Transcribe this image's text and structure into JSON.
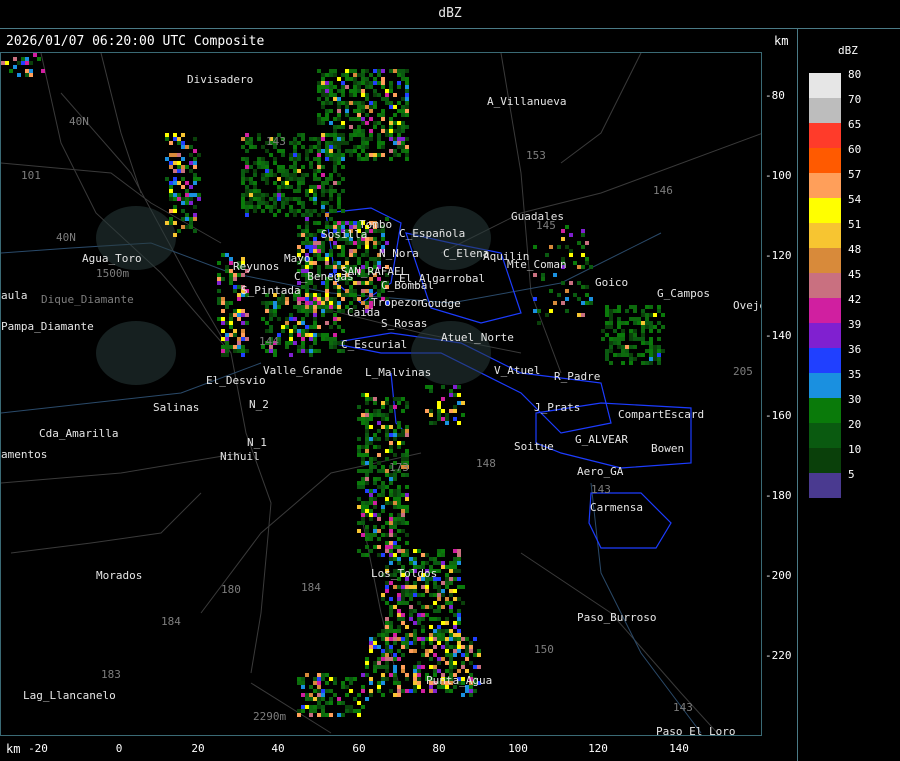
{
  "colorbar": {
    "title": "dBZ",
    "levels": [
      {
        "value": "80",
        "color": "#e6e6e6"
      },
      {
        "value": "70",
        "color": "#bdbdbd"
      },
      {
        "value": "65",
        "color": "#ff3b2a"
      },
      {
        "value": "60",
        "color": "#ff5a00"
      },
      {
        "value": "57",
        "color": "#ff9f5a"
      },
      {
        "value": "54",
        "color": "#ffff00"
      },
      {
        "value": "51",
        "color": "#f7c531"
      },
      {
        "value": "48",
        "color": "#d88a3a"
      },
      {
        "value": "45",
        "color": "#c97080"
      },
      {
        "value": "42",
        "color": "#d01fa0"
      },
      {
        "value": "39",
        "color": "#8020d0"
      },
      {
        "value": "36",
        "color": "#2040ff"
      },
      {
        "value": "35",
        "color": "#1a90e0"
      },
      {
        "value": "30",
        "color": "#0a7a0a"
      },
      {
        "value": "20",
        "color": "#0a5a10"
      },
      {
        "value": "10",
        "color": "#0a400a"
      },
      {
        "value": "5",
        "color": "#4a3a90"
      }
    ]
  },
  "header": {
    "timestamp": "2026/01/07 06:20:00 UTC Composite",
    "unit_top": "km",
    "unit_bottom": "km"
  },
  "axes": {
    "y_ticks": [
      "-80",
      "-100",
      "-120",
      "-140",
      "-160",
      "-180",
      "-200",
      "-220"
    ],
    "x_ticks": [
      "-20",
      "0",
      "20",
      "40",
      "60",
      "80",
      "100",
      "120",
      "140"
    ]
  },
  "places": [
    {
      "name": "Divisadero"
    },
    {
      "name": "A_Villanueva"
    },
    {
      "name": "Guadales"
    },
    {
      "name": "Agua_Toro"
    },
    {
      "name": "Reyunos"
    },
    {
      "name": "S_Pintada"
    },
    {
      "name": "C_Benegas"
    },
    {
      "name": "C_Española"
    },
    {
      "name": "C_Elena"
    },
    {
      "name": "Aquilin"
    },
    {
      "name": "Mte_Coman"
    },
    {
      "name": "Goico"
    },
    {
      "name": "G_Campos"
    },
    {
      "name": "Ovejer"
    },
    {
      "name": "Pampa_Diamante"
    },
    {
      "name": "Valle_Grande"
    },
    {
      "name": "El_Desvio"
    },
    {
      "name": "Salinas"
    },
    {
      "name": "Cda_Amarilla"
    },
    {
      "name": "amentos"
    },
    {
      "name": "N_2"
    },
    {
      "name": "N_1"
    },
    {
      "name": "Nihuil"
    },
    {
      "name": "L_Malvinas"
    },
    {
      "name": "Atuel_Norte"
    },
    {
      "name": "V_Atuel"
    },
    {
      "name": "R_Padre"
    },
    {
      "name": "J_Prats"
    },
    {
      "name": "CompartEscard"
    },
    {
      "name": "G_ALVEAR"
    },
    {
      "name": "Bowen"
    },
    {
      "name": "Soitue"
    },
    {
      "name": "Aero_GA"
    },
    {
      "name": "Carmensa"
    },
    {
      "name": "Morados"
    },
    {
      "name": "Los_Toldos"
    },
    {
      "name": "Paso_Burroso"
    },
    {
      "name": "Punta_Agua"
    },
    {
      "name": "Lag_Llancanelo"
    },
    {
      "name": "Paso_El_Loro"
    },
    {
      "name": "S_Rosas"
    },
    {
      "name": "C_Bombal"
    },
    {
      "name": "Tropezon"
    },
    {
      "name": "Goudge"
    },
    {
      "name": "El_Algarrobal"
    },
    {
      "name": "C_Escurial"
    },
    {
      "name": "Caida"
    },
    {
      "name": "Mayo"
    },
    {
      "name": "Sosilla"
    },
    {
      "name": "Tombo"
    },
    {
      "name": "N_Nora"
    },
    {
      "name": "aula"
    },
    {
      "name": "Dique_Diamante"
    },
    {
      "name": "SAN_RAFAEL"
    }
  ],
  "road_labels": [
    "40N",
    "40N",
    "101",
    "143",
    "153",
    "146",
    "184",
    "184",
    "183",
    "180",
    "143",
    "150",
    "143",
    "205",
    "2290m",
    "1500m",
    "148",
    "145",
    "144",
    "173"
  ]
}
